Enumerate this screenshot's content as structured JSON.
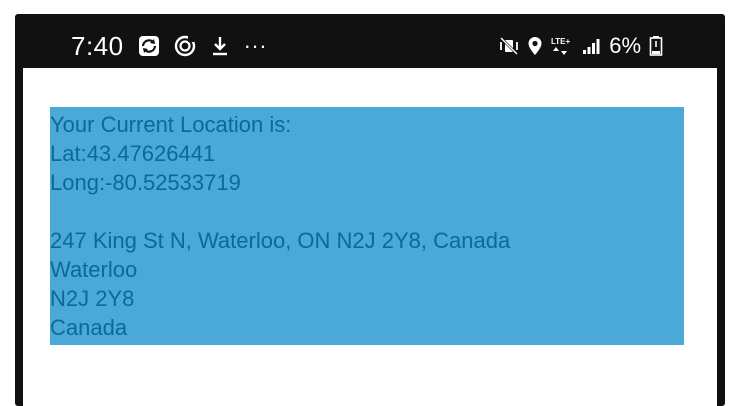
{
  "status_bar": {
    "time": "7:40",
    "battery_percent": "6%",
    "network_type_label": "LTE+",
    "left_icons": [
      "gallery-sync-icon",
      "circular-sync-icon",
      "download-icon",
      "more-dots-icon"
    ],
    "right_icons": [
      "mute-vibrate-icon",
      "location-pin-icon",
      "lte-data-icon",
      "signal-bars-icon",
      "battery-low-icon"
    ],
    "more_dots": "···"
  },
  "location": {
    "heading": "Your Current Location is:",
    "latitude_line": "Lat:43.47626441",
    "longitude_line": "Long:-80.52533719",
    "address_line": "247 King St N, Waterloo, ON N2J 2Y8, Canada",
    "city": "Waterloo",
    "postal_code": "N2J 2Y8",
    "country": "Canada"
  },
  "colors": {
    "panel_background": "#4aa9d6",
    "panel_text": "#0b6a9a",
    "status_bar_background": "#111111"
  }
}
